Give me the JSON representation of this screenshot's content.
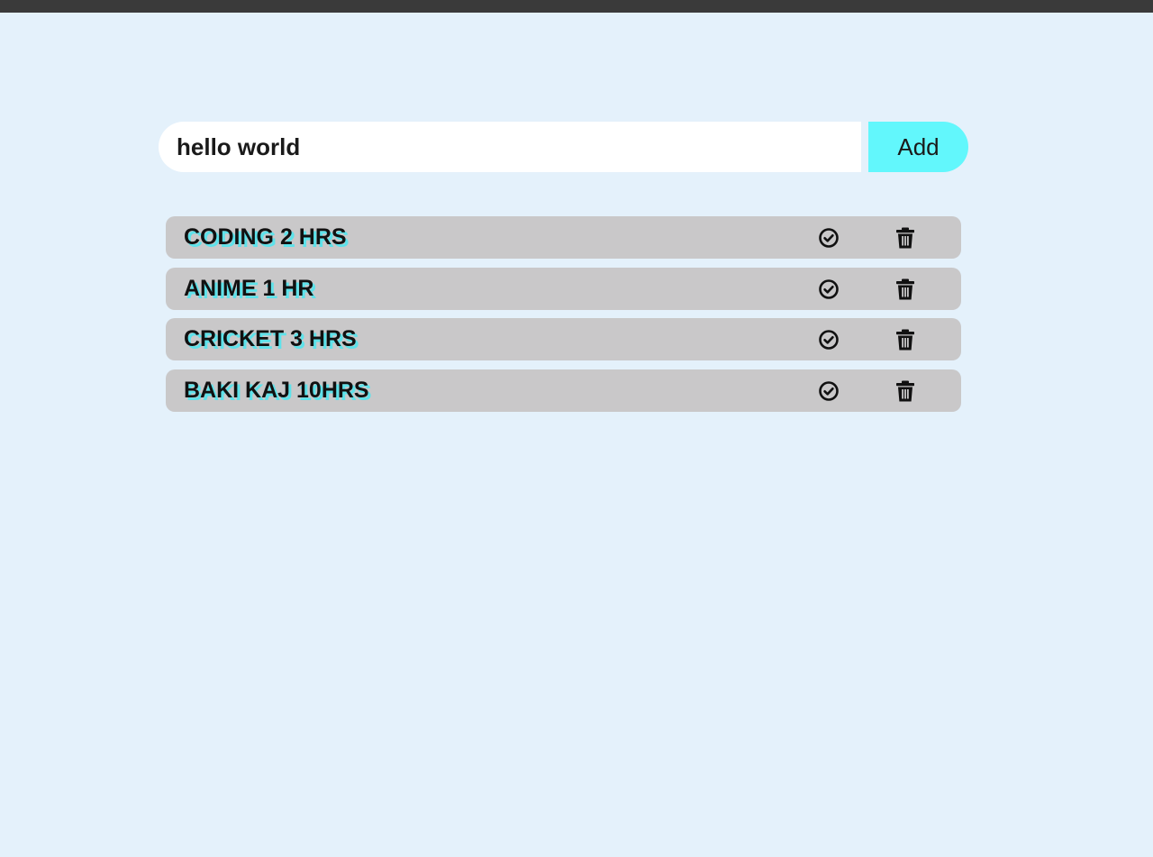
{
  "input": {
    "value": "hello world",
    "placeholder": ""
  },
  "add_button": {
    "label": "Add"
  },
  "tasks": [
    {
      "text": "CODING 2 HRS",
      "complete_icon": "check-circle-icon",
      "delete_icon": "trash-icon"
    },
    {
      "text": "ANIME 1 HR",
      "complete_icon": "check-circle-icon",
      "delete_icon": "trash-icon"
    },
    {
      "text": "CRICKET 3 HRS",
      "complete_icon": "check-circle-icon",
      "delete_icon": "trash-icon"
    },
    {
      "text": "BAKI KAJ 10HRS",
      "complete_icon": "check-circle-icon",
      "delete_icon": "trash-icon"
    }
  ],
  "colors": {
    "background": "#e4f1fb",
    "accent": "#62f7fc",
    "task_background": "#c9c8c9",
    "text_shadow": "#5de2ea"
  }
}
